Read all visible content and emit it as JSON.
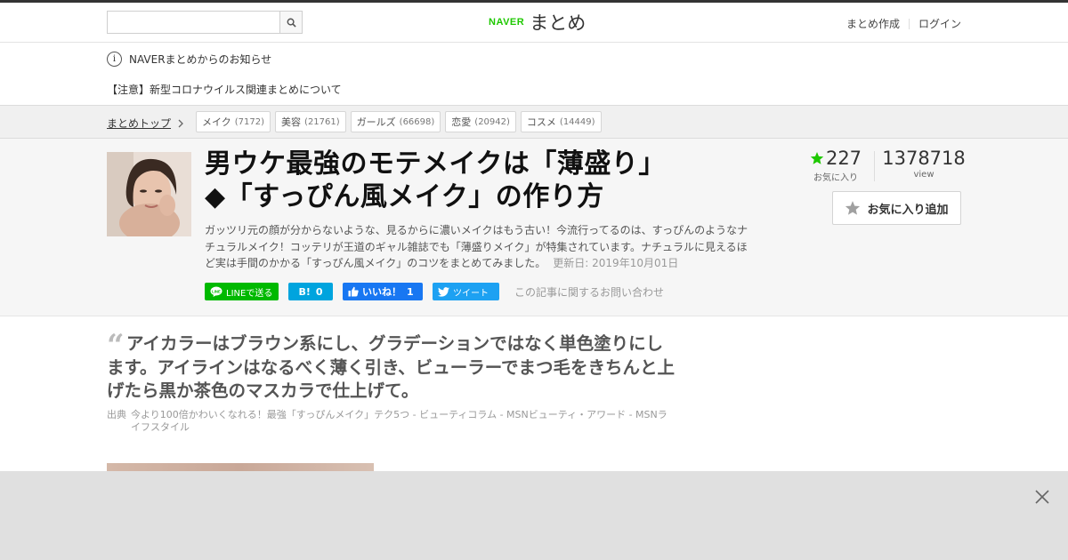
{
  "header": {
    "search": {
      "placeholder": "",
      "value": ""
    },
    "logo": {
      "brand": "NAVER",
      "service": "まとめ"
    },
    "links": {
      "create": "まとめ作成",
      "login": "ログイン"
    }
  },
  "notices": {
    "info": "NAVERまとめからのお知らせ",
    "corona": "【注意】新型コロナウイルス関連まとめについて"
  },
  "categories": {
    "top_link": "まとめトップ",
    "tags": [
      {
        "name": "メイク",
        "count": "(7172)"
      },
      {
        "name": "美容",
        "count": "(21761)"
      },
      {
        "name": "ガールズ",
        "count": "(66698)"
      },
      {
        "name": "恋愛",
        "count": "(20942)"
      },
      {
        "name": "コスメ",
        "count": "(14449)"
      }
    ]
  },
  "article": {
    "title_line1": "男ウケ最強のモテメイクは「薄盛り」",
    "title_line2": "◆「すっぴん風メイク」の作り方",
    "description": "ガッツリ元の顔が分からないような、見るからに濃いメイクはもう古い！今流行ってるのは、すっぴんのようなナチュラルメイク！コッテリが王道のギャル雑誌でも「薄盛りメイク」が特集されています。ナチュラルに見えるほど実は手間のかかる「すっぴん風メイク」のコツをまとめてみました。",
    "updated": "更新日: 2019年10月01日",
    "favorites": "227",
    "favorites_label": "お気に入り",
    "views": "1378718",
    "views_label": "view",
    "fav_button": "お気に入り追加",
    "inquiry": "この記事に関するお問い合わせ"
  },
  "share": {
    "line": "LINEで送る",
    "hatena_icon": "B!",
    "hatena_count": "0",
    "facebook": "いいね！",
    "facebook_count": "1",
    "twitter": "ツイート"
  },
  "quote": {
    "text": "アイカラーはブラウン系にし、グラデーションではなく単色塗りにします。アイラインはなるべく薄く引き、ビューラーでまつ毛をきちんと上げたら黒か茶色のマスカラで仕上げて。",
    "source_label": "出典",
    "source": "今より100倍かわいくなれる！最強「すっぴんメイク」テク5つ - ビューティコラム - MSNビューティ・アワード - MSNライフスタイル"
  },
  "colors": {
    "brand_green": "#1ec800",
    "line_green": "#00b900",
    "hatena_blue": "#00a4de",
    "facebook_blue": "#1877f2",
    "twitter_blue": "#1da1f2"
  }
}
